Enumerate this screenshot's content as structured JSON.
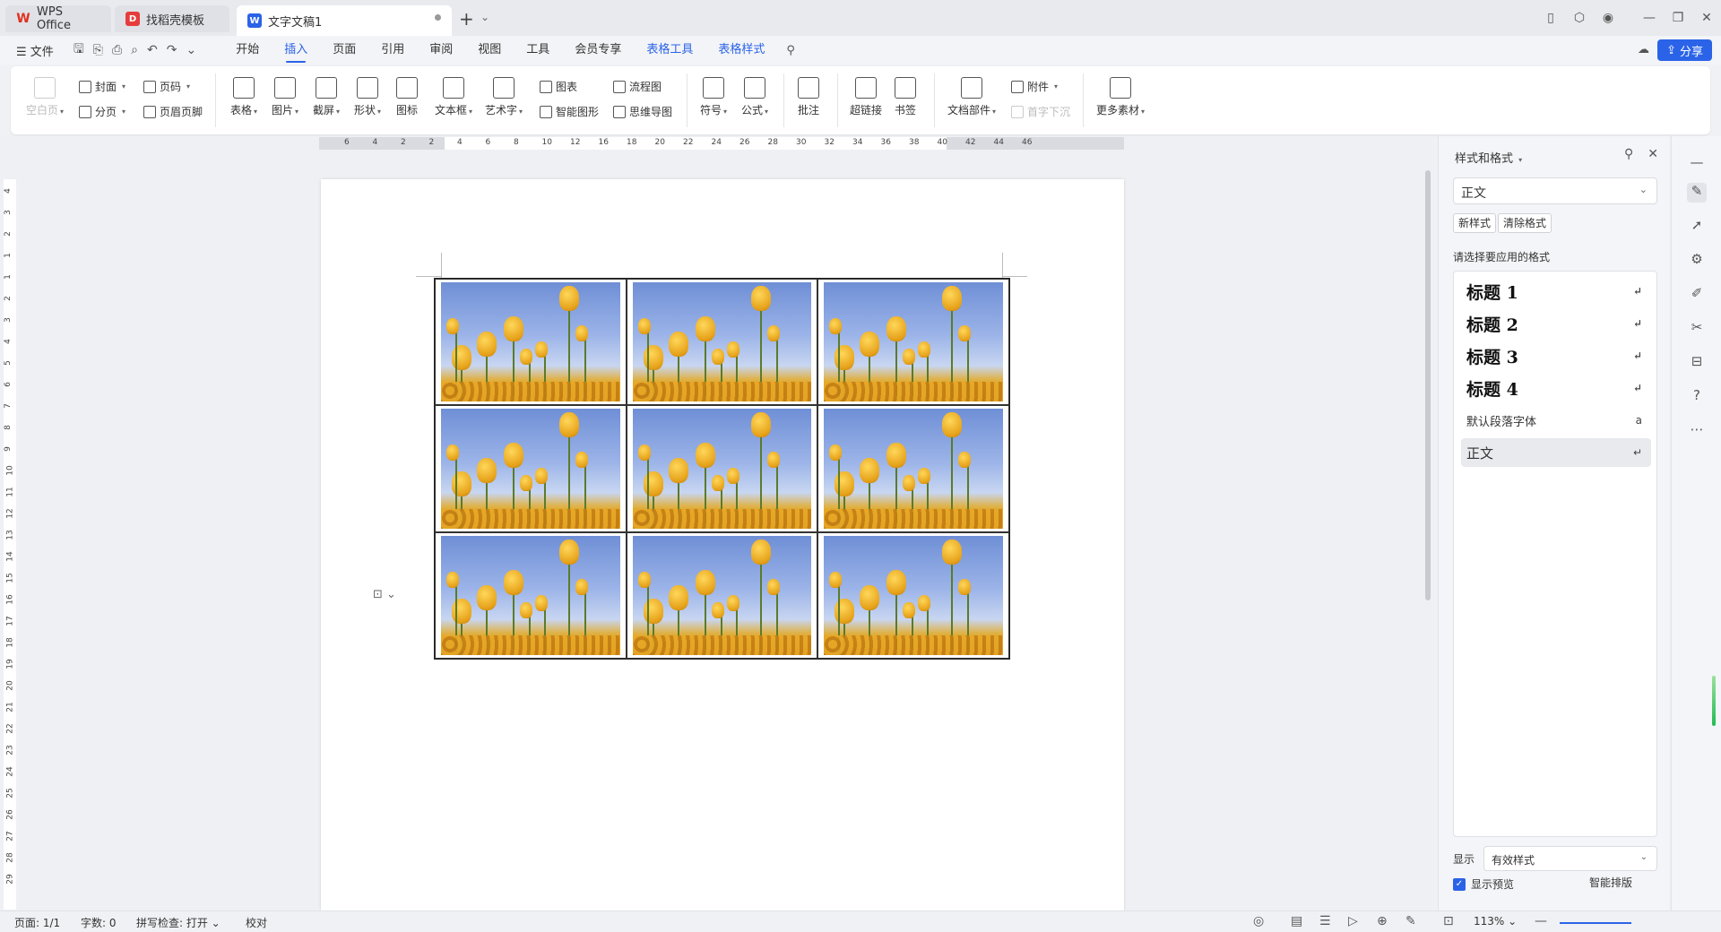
{
  "tabs": [
    {
      "label": "WPS Office",
      "icon": "wps-logo-icon"
    },
    {
      "label": "找稻壳模板",
      "icon": "daoke-template-icon"
    },
    {
      "label": "文字文稿1",
      "icon": "writer-doc-icon"
    }
  ],
  "menu": {
    "file": "文件",
    "tabs": [
      "开始",
      "插入",
      "页面",
      "引用",
      "审阅",
      "视图",
      "工具",
      "会员专享"
    ],
    "context_tabs": [
      "表格工具",
      "表格样式"
    ],
    "active_tab": "插入",
    "share": "分享"
  },
  "ribbon": {
    "blank_page": "空白页",
    "cover": "封面",
    "page_break": "分页",
    "page_number": "页码",
    "header_footer": "页眉页脚",
    "table": "表格",
    "picture": "图片",
    "screenshot": "截屏",
    "shape": "形状",
    "icon": "图标",
    "textbox": "文本框",
    "wordart": "艺术字",
    "chart": "图表",
    "smart_graphic": "智能图形",
    "flowchart": "流程图",
    "mindmap": "思维导图",
    "symbol": "符号",
    "formula": "公式",
    "comment": "批注",
    "hyperlink": "超链接",
    "bookmark": "书签",
    "doc_parts": "文档部件",
    "attachment": "附件",
    "drop_cap": "首字下沉",
    "more_materials": "更多素材"
  },
  "ruler": {
    "h_ticks": [
      "6",
      "4",
      "2",
      "2",
      "4",
      "6",
      "8",
      "10",
      "12",
      "16",
      "18",
      "20",
      "22",
      "24",
      "26",
      "28",
      "30",
      "32",
      "34",
      "36",
      "38",
      "40",
      "42",
      "44",
      "46"
    ],
    "v_ticks": [
      "4",
      "3",
      "2",
      "1",
      "1",
      "2",
      "3",
      "4",
      "5",
      "6",
      "7",
      "8",
      "9",
      "10",
      "11",
      "12",
      "13",
      "14",
      "15",
      "16",
      "17",
      "18",
      "19",
      "20",
      "21",
      "22",
      "23",
      "24",
      "25",
      "26",
      "27",
      "28",
      "29"
    ]
  },
  "panel": {
    "title": "样式和格式",
    "current_style": "正文",
    "new_style": "新样式",
    "clear_format": "清除格式",
    "prompt": "请选择要应用的格式",
    "styles": [
      {
        "name": "标题 1",
        "mark": "↵"
      },
      {
        "name": "标题 2",
        "mark": "↵"
      },
      {
        "name": "标题 3",
        "mark": "↵"
      },
      {
        "name": "标题 4",
        "mark": "↵"
      },
      {
        "name": "默认段落字体",
        "mark": "a"
      },
      {
        "name": "正文",
        "mark": "↵"
      }
    ],
    "show_label": "显示",
    "show_value": "有效样式",
    "preview_label": "显示预览",
    "smart_layout": "智能排版"
  },
  "status": {
    "page": "页面: 1/1",
    "words": "字数: 0",
    "spell": "拼写检查: 打开",
    "proof": "校对",
    "zoom": "113%"
  },
  "colors": {
    "accent": "#2b63e8"
  }
}
